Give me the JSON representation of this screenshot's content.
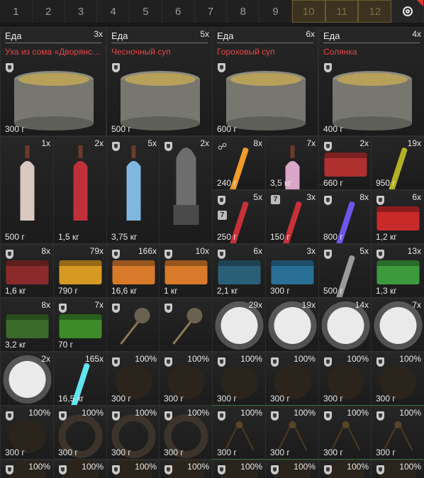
{
  "tabs": [
    {
      "label": "1",
      "locked": false
    },
    {
      "label": "2",
      "locked": false
    },
    {
      "label": "3",
      "locked": false
    },
    {
      "label": "4",
      "locked": false
    },
    {
      "label": "5",
      "locked": false
    },
    {
      "label": "6",
      "locked": false
    },
    {
      "label": "7",
      "locked": false
    },
    {
      "label": "8",
      "locked": false
    },
    {
      "label": "9",
      "locked": false
    },
    {
      "label": "10",
      "locked": true
    },
    {
      "label": "11",
      "locked": true
    },
    {
      "label": "12",
      "locked": true
    }
  ],
  "settings_icon": "radio-target-icon",
  "food": [
    {
      "category": "Еда",
      "count": "3x",
      "name": "Уха из сома «Дворянская»",
      "weight": "300 г"
    },
    {
      "category": "Еда",
      "count": "5x",
      "name": "Чесночный суп",
      "weight": "500 г"
    },
    {
      "category": "Еда",
      "count": "6x",
      "name": "Гороховый суп",
      "weight": "600 г"
    },
    {
      "category": "Еда",
      "count": "4x",
      "name": "Солянка",
      "weight": "400 г"
    }
  ],
  "items": [
    {
      "count": "1x",
      "weight": "500 г",
      "icon": "wine-bottle-white-icon"
    },
    {
      "count": "2x",
      "weight": "1,5 кг",
      "icon": "wine-bottle-red-icon"
    },
    {
      "count": "5x",
      "weight": "3,75 кг",
      "icon": "vodka-bottle-blue-icon",
      "marker": "shield"
    },
    {
      "count": "2x",
      "weight": "",
      "icon": "bomb-icon",
      "marker": "shield"
    },
    {
      "count": "8x",
      "weight": "240 г",
      "icon": "glowstick-orange-icon",
      "marker": "chain"
    },
    {
      "count": "7x",
      "weight": "3,5 кг",
      "icon": "pink-bottle-icon"
    },
    {
      "count": "2x",
      "weight": "660 г",
      "icon": "spray-can-icon",
      "marker": "shield"
    },
    {
      "count": "19x",
      "weight": "950 г",
      "icon": "flare-stick-icon"
    },
    {
      "count": "5x",
      "weight": "250 г",
      "icon": "red-stick-icon",
      "marker": "shield",
      "badge": "7"
    },
    {
      "count": "3x",
      "weight": "150 г",
      "icon": "red-stick-icon",
      "badge": "7"
    },
    {
      "count": "8x",
      "weight": "800 г",
      "icon": "glowstick-purple-icon",
      "marker": "shield"
    },
    {
      "count": "6x",
      "weight": "1,2 кг",
      "icon": "red-case-icon",
      "marker": "shield"
    },
    {
      "count": "8x",
      "weight": "1,6 кг",
      "icon": "weapon-case-icon",
      "marker": "shield"
    },
    {
      "count": "79x",
      "weight": "790 г",
      "icon": "yellow-box-icon"
    },
    {
      "count": "166x",
      "weight": "16,6 кг",
      "icon": "orange-crate-icon",
      "marker": "shield"
    },
    {
      "count": "10x",
      "weight": "1 кг",
      "icon": "orange-crate-icon",
      "marker": "shield"
    },
    {
      "count": "6x",
      "weight": "2,1 кг",
      "icon": "blue-device-icon",
      "marker": "shield"
    },
    {
      "count": "3x",
      "weight": "300 г",
      "icon": "blue-canister-icon"
    },
    {
      "count": "5x",
      "weight": "500 г",
      "icon": "syringe-icon",
      "marker": "shield"
    },
    {
      "count": "13x",
      "weight": "1,3 кг",
      "icon": "green-crate-icon",
      "marker": "shield"
    },
    {
      "count": "8x",
      "weight": "3,2 кг",
      "icon": "green-can-icon"
    },
    {
      "count": "7x",
      "weight": "70 г",
      "icon": "green-box-icon",
      "marker": "shield"
    },
    {
      "count": "",
      "weight": "",
      "icon": "plant-branch-icon",
      "marker": "shield"
    },
    {
      "count": "",
      "weight": "",
      "icon": "plant-branch-icon",
      "marker": "shield"
    },
    {
      "count": "29x",
      "weight": "",
      "icon": "white-cloud-icon"
    },
    {
      "count": "19x",
      "weight": "",
      "icon": "white-cloud-icon"
    },
    {
      "count": "14x",
      "weight": "",
      "icon": "white-cloud-icon"
    },
    {
      "count": "7x",
      "weight": "",
      "icon": "white-cloud-icon"
    },
    {
      "count": "2x",
      "weight": "",
      "icon": "white-cloud-icon"
    },
    {
      "count": "165x",
      "weight": "16,5 кг",
      "icon": "cyan-glowstick-icon"
    },
    {
      "count": "100%",
      "weight": "300 г",
      "icon": "dark-artifact-icon",
      "marker": "shield"
    },
    {
      "count": "100%",
      "weight": "300 г",
      "icon": "dark-artifact-icon",
      "marker": "shield"
    },
    {
      "count": "100%",
      "weight": "300 г",
      "icon": "dark-artifact-icon",
      "marker": "shield"
    },
    {
      "count": "100%",
      "weight": "300 г",
      "icon": "dark-artifact-icon",
      "marker": "shield"
    },
    {
      "count": "100%",
      "weight": "300 г",
      "icon": "dark-artifact-icon",
      "marker": "shield"
    },
    {
      "count": "100%",
      "weight": "300 г",
      "icon": "dark-artifact-icon",
      "marker": "shield"
    },
    {
      "count": "100%",
      "weight": "300 г",
      "icon": "dark-artifact-icon",
      "marker": "shield"
    },
    {
      "count": "100%",
      "weight": "300 г",
      "icon": "ring-artifact-icon",
      "marker": "shield"
    },
    {
      "count": "100%",
      "weight": "300 г",
      "icon": "ring-artifact-icon",
      "marker": "shield"
    },
    {
      "count": "100%",
      "weight": "300 г",
      "icon": "ring-artifact-icon",
      "marker": "shield"
    },
    {
      "count": "100%",
      "weight": "300 г",
      "icon": "bush-artifact-icon",
      "marker": "shield"
    },
    {
      "count": "100%",
      "weight": "300 г",
      "icon": "bush-artifact-icon",
      "marker": "shield"
    },
    {
      "count": "100%",
      "weight": "300 г",
      "icon": "bush-artifact-icon",
      "marker": "shield"
    },
    {
      "count": "100%",
      "weight": "300 г",
      "icon": "bush-artifact-icon",
      "marker": "shield"
    },
    {
      "count": "100%",
      "weight": "",
      "icon": "dark-artifact-icon",
      "marker": "shield"
    },
    {
      "count": "100%",
      "weight": "",
      "icon": "dark-artifact-icon",
      "marker": "shield"
    },
    {
      "count": "100%",
      "weight": "",
      "icon": "dark-artifact-icon",
      "marker": "shield"
    },
    {
      "count": "100%",
      "weight": "",
      "icon": "dark-artifact-icon",
      "marker": "shield"
    },
    {
      "count": "100%",
      "weight": "",
      "icon": "dark-artifact-icon",
      "marker": "shield"
    },
    {
      "count": "100%",
      "weight": "",
      "icon": "dark-artifact-icon",
      "marker": "shield"
    },
    {
      "count": "100%",
      "weight": "",
      "icon": "dark-artifact-icon",
      "marker": "shield"
    },
    {
      "count": "100%",
      "weight": "",
      "icon": "dark-artifact-icon",
      "marker": "shield"
    }
  ]
}
